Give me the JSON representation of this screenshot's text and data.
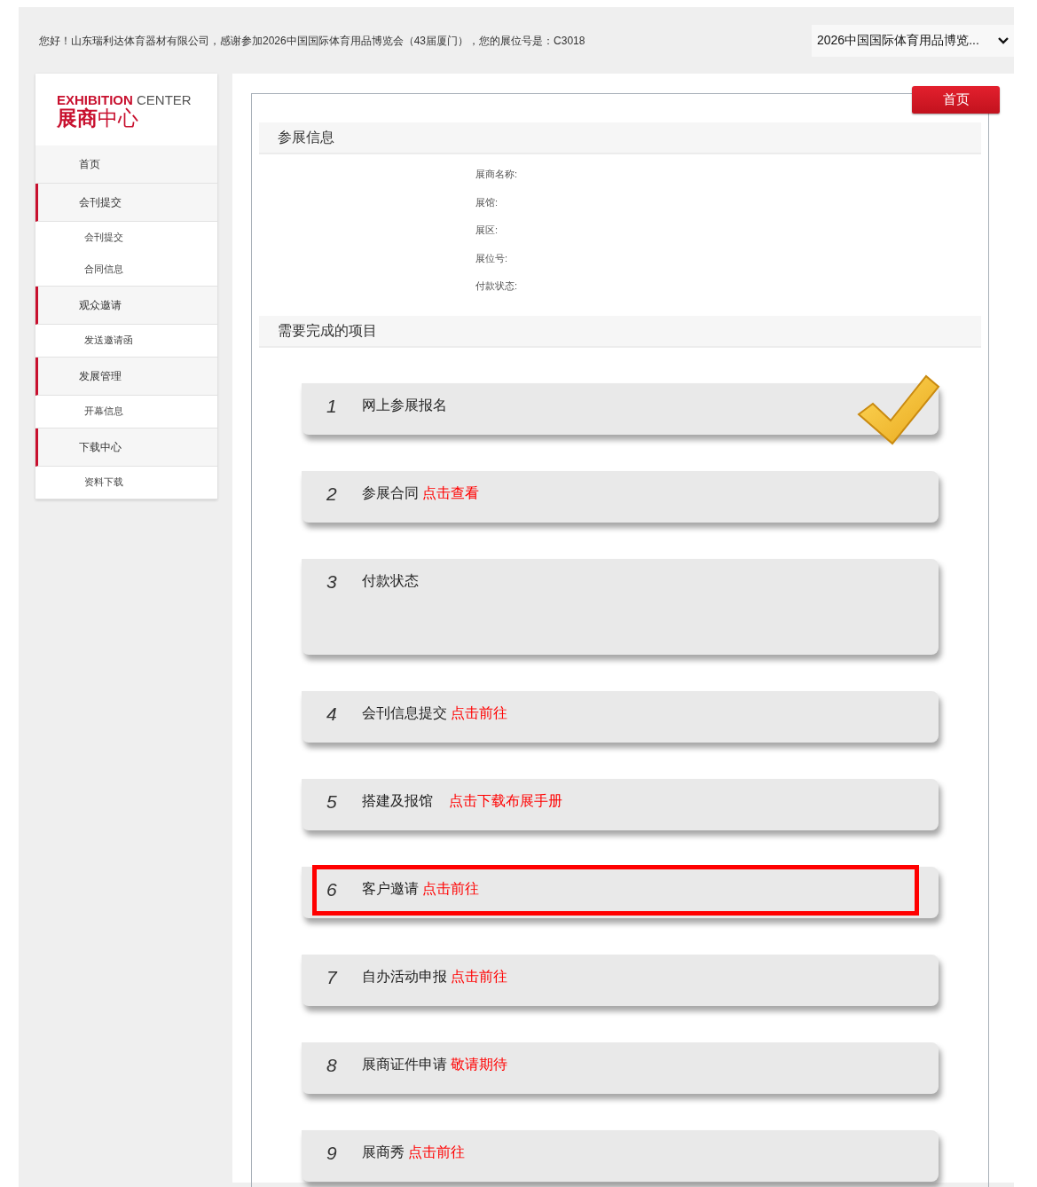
{
  "top_bar": {
    "greeting": "您好！山东瑞利达体育器材有限公司，感谢参加2026中国国际体育用品博览会（43届厦门），您的展位号是：C3018",
    "exhibition_select": "2026中国国际体育用品博览..."
  },
  "sidebar": {
    "logo_en_bold": "EXHIBITION",
    "logo_en": "CENTER",
    "logo_cn_bold": "展商",
    "logo_cn": "中心",
    "items": [
      {
        "label": "首页",
        "kind": "home"
      },
      {
        "label": "会刊提交",
        "kind": "group",
        "children": [
          {
            "label": "会刊提交"
          },
          {
            "label": "合同信息"
          }
        ]
      },
      {
        "label": "观众邀请",
        "kind": "group",
        "children": [
          {
            "label": "发送邀请函"
          }
        ]
      },
      {
        "label": "发展管理",
        "kind": "group",
        "children": [
          {
            "label": "开幕信息"
          }
        ]
      },
      {
        "label": "下载中心",
        "kind": "group",
        "children": [
          {
            "label": "资料下载"
          }
        ]
      }
    ]
  },
  "home_button": "首页",
  "info_section": {
    "title": "参展信息",
    "fields": [
      "展商名称:",
      "展馆:",
      "展区:",
      "展位号:",
      "付款状态:"
    ]
  },
  "tasks_section": {
    "title": "需要完成的项目",
    "items": [
      {
        "number": "1",
        "title": "网上参展报名",
        "done": true,
        "highlighted": false,
        "tall": false
      },
      {
        "number": "2",
        "title": "参展合同",
        "link": "点击查看",
        "done": false,
        "highlighted": false,
        "tall": false
      },
      {
        "number": "3",
        "title": "付款状态",
        "done": false,
        "highlighted": false,
        "tall": true
      },
      {
        "number": "4",
        "title": "会刊信息提交",
        "link": "点击前往",
        "done": false,
        "highlighted": false,
        "tall": false
      },
      {
        "number": "5",
        "title": "搭建及报馆",
        "link": "点击下载布展手册",
        "done": false,
        "highlighted": false,
        "tall": false
      },
      {
        "number": "6",
        "title": "客户邀请",
        "link": "点击前往",
        "done": false,
        "highlighted": true,
        "tall": false
      },
      {
        "number": "7",
        "title": "自办活动申报",
        "link": "点击前往",
        "done": false,
        "highlighted": false,
        "tall": false
      },
      {
        "number": "8",
        "title": "展商证件申请",
        "link": "敬请期待",
        "done": false,
        "highlighted": false,
        "tall": false
      },
      {
        "number": "9",
        "title": "展商秀",
        "link": "点击前往",
        "done": false,
        "highlighted": false,
        "tall": false
      }
    ]
  }
}
